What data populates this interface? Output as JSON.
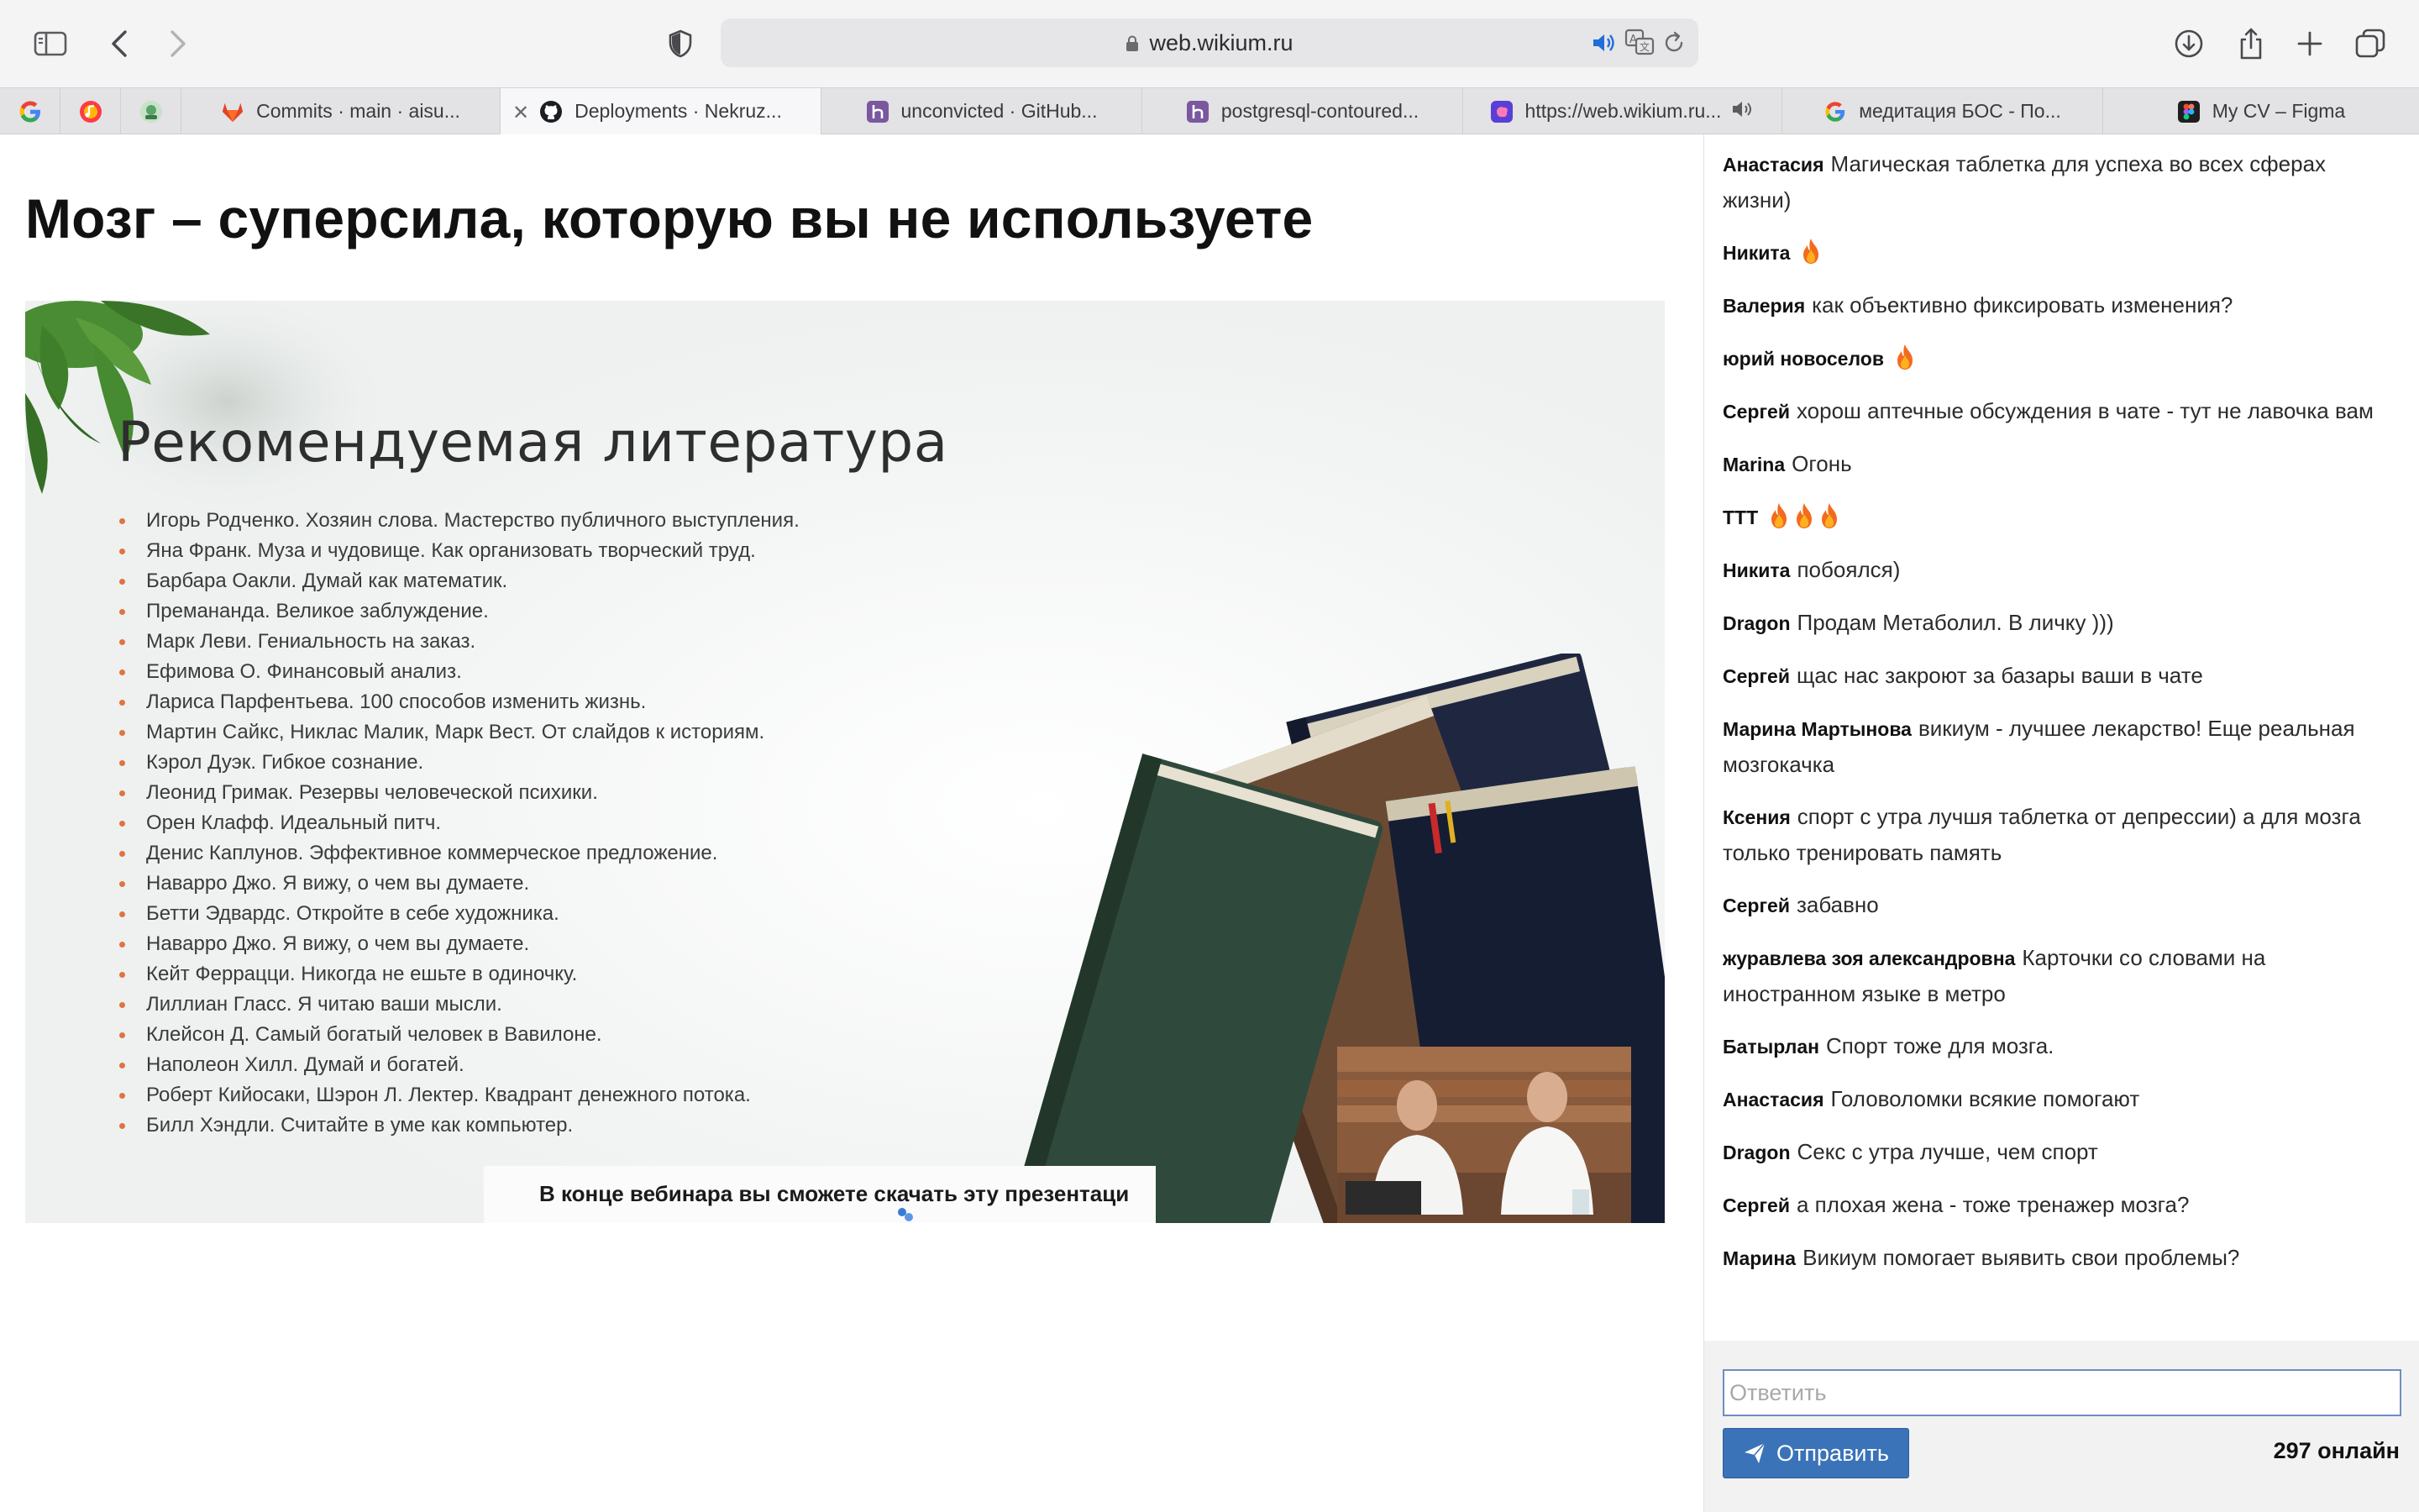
{
  "browser": {
    "url": "web.wikium.ru",
    "pinned_tabs": [
      {
        "icon": "google-icon"
      },
      {
        "icon": "music-app-icon"
      },
      {
        "icon": "app-icon"
      }
    ],
    "tabs": [
      {
        "label": "Commits · main · aisu...",
        "icon": "gitlab-icon"
      },
      {
        "label": "Deployments · Nekruz...",
        "icon": "github-icon"
      },
      {
        "label": "unconvicted · GitHub...",
        "icon": "heroku-icon"
      },
      {
        "label": "postgresql-contoured...",
        "icon": "heroku-icon"
      },
      {
        "label": "https://web.wikium.ru...",
        "icon": "wikium-icon"
      },
      {
        "label": "медитация БОС - По...",
        "icon": "google-icon"
      },
      {
        "label": "My CV – Figma",
        "icon": "figma-icon"
      }
    ]
  },
  "page": {
    "title": "Мозг – суперсила, которую вы не используете"
  },
  "slide": {
    "heading": "Рекомендуемая литература",
    "books": [
      "Игорь Родченко. Хозяин слова. Мастерство публичного выступления.",
      "Яна Франк. Муза и чудовище. Как организовать творческий труд.",
      "Барбара Оакли. Думай как математик.",
      "Премананда. Великое заблуждение.",
      "Марк Леви. Гениальность на заказ.",
      "Ефимова О. Финансовый анализ.",
      "Лариса Парфентьева. 100 способов изменить жизнь.",
      "Мартин Сайкс, Никлас Малик, Марк Вест. От слайдов к историям.",
      "Кэрол Дуэк. Гибкое сознание.",
      "Леонид Гримак. Резервы человеческой психики.",
      "Орен Клафф. Идеальный питч.",
      "Денис Каплунов. Эффективное коммерческое предложение.",
      "Наварро Джо. Я вижу, о чем вы думаете.",
      "Бетти Эдвардс. Откройте в себе художника.",
      "Наварро Джо. Я вижу, о чем вы думаете.",
      "Кейт Феррацци. Никогда не ешьте в одиночку.",
      "Лиллиан Гласс. Я читаю ваши мысли.",
      "Клейсон Д. Самый богатый человек в Вавилоне.",
      "Наполеон Хилл. Думай и богатей.",
      "Роберт Кийосаки, Шэрон Л. Лектер. Квадрант денежного потока.",
      "Билл Хэндли. Считайте в уме как компьютер."
    ],
    "caption": "В конце вебинара вы сможете скачать эту презентаци"
  },
  "chat": {
    "messages": [
      {
        "author": "Анастасия",
        "text": "Магическая таблетка для успеха во всех сферах жизни)",
        "fire": 0
      },
      {
        "author": "Никита",
        "text": "",
        "fire": 1
      },
      {
        "author": "Валерия",
        "text": "как объективно фиксировать изменения?",
        "fire": 0
      },
      {
        "author": "юрий новоселов",
        "text": "",
        "fire": 1
      },
      {
        "author": "Сергей",
        "text": "хорош аптечные обсуждения в чате - тут не лавочка вам",
        "fire": 0
      },
      {
        "author": "Marina",
        "text": "Огонь",
        "fire": 0
      },
      {
        "author": "ТТТ",
        "text": "",
        "fire": 3
      },
      {
        "author": "Никита",
        "text": "побоялся)",
        "fire": 0
      },
      {
        "author": "Dragon",
        "text": "Продам Метаболил. В личку )))",
        "fire": 0
      },
      {
        "author": "Сергей",
        "text": "щас нас закроют за базары ваши в чате",
        "fire": 0
      },
      {
        "author": "Марина Мартынова",
        "text": "викиум - лучшее лекарство! Еще реальная мозгокачка",
        "fire": 0
      },
      {
        "author": "Ксения",
        "text": "спорт с утра лучшя таблетка от депрессии) а для мозга только тренировать память",
        "fire": 0
      },
      {
        "author": "Сергей",
        "text": "забавно",
        "fire": 0
      },
      {
        "author": "журавлева зоя александровна",
        "text": "Карточки со словами на иностранном языке в метро",
        "fire": 0
      },
      {
        "author": "Батырлан",
        "text": "Спорт тоже для мозга.",
        "fire": 0
      },
      {
        "author": "Анастасия",
        "text": "Головоломки всякие помогают",
        "fire": 0
      },
      {
        "author": "Dragon",
        "text": "Секс с утра лучше, чем спорт",
        "fire": 0
      },
      {
        "author": "Сергей",
        "text": "а плохая жена - тоже тренажер мозга?",
        "fire": 0
      },
      {
        "author": "Марина",
        "text": "Викиум помогает выявить свои проблемы?",
        "fire": 0
      }
    ],
    "reply_placeholder": "Ответить",
    "reply_value": "",
    "send_label": "Отправить",
    "online_count": "297 онлайн"
  },
  "colors": {
    "accent": "#3a73b8",
    "bullet": "#e0733e",
    "input_border": "#6d8ec0"
  }
}
